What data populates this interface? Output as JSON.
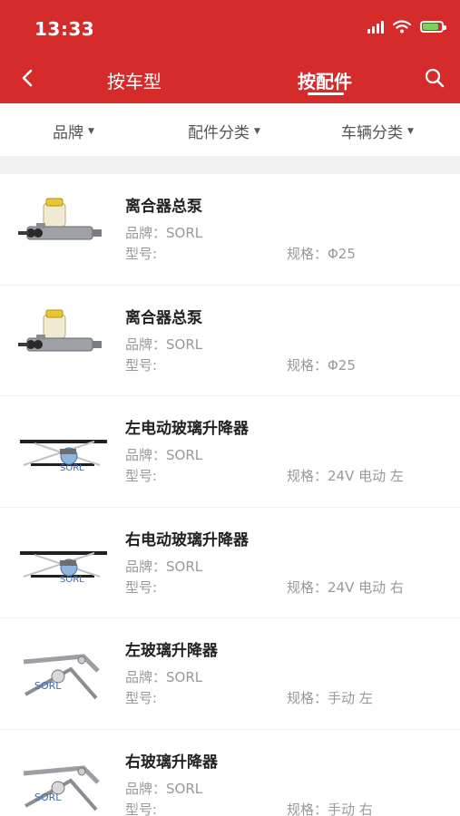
{
  "status": {
    "time": "13:33"
  },
  "nav": {
    "tab_by_vehicle": "按车型",
    "tab_by_part": "按配件"
  },
  "filters": [
    {
      "label": "品牌"
    },
    {
      "label": "配件分类"
    },
    {
      "label": "车辆分类"
    }
  ],
  "products": [
    {
      "name": "离合器总泵",
      "brand": "品牌：SORL",
      "model": "型号:",
      "spec": "规格：Φ25",
      "image": "clutch-master-cylinder"
    },
    {
      "name": "离合器总泵",
      "brand": "品牌：SORL",
      "model": "型号:",
      "spec": "规格：Φ25",
      "image": "clutch-master-cylinder"
    },
    {
      "name": "左电动玻璃升降器",
      "brand": "品牌：SORL",
      "model": "型号:",
      "spec": "规格：24V 电动 左",
      "image": "electric-window-regulator"
    },
    {
      "name": "右电动玻璃升降器",
      "brand": "品牌：SORL",
      "model": "型号:",
      "spec": "规格：24V 电动 右",
      "image": "electric-window-regulator"
    },
    {
      "name": "左玻璃升降器",
      "brand": "品牌：SORL",
      "model": "型号:",
      "spec": "规格：手动 左",
      "image": "manual-window-regulator"
    },
    {
      "name": "右玻璃升降器",
      "brand": "品牌：SORL",
      "model": "型号:",
      "spec": "规格：手动 右",
      "image": "manual-window-regulator"
    }
  ],
  "colors": {
    "header": "#d52b2b",
    "battery": "#7ad35a"
  }
}
